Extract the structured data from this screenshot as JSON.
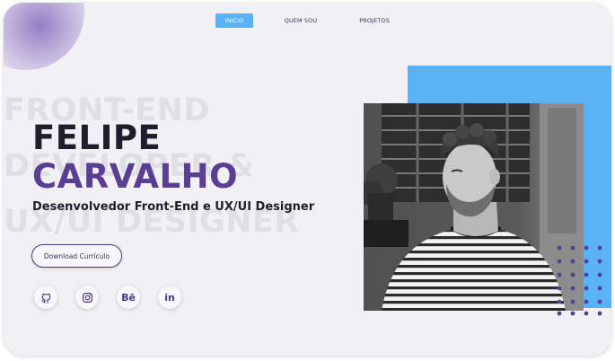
{
  "nav": {
    "items": [
      "INICIO",
      "QUEM SOU",
      "PROJETOS"
    ],
    "active": "INICIO"
  },
  "hero": {
    "background_lines": [
      "FRONT-END",
      "DEVELOPER &",
      "UX/UI DESIGNER"
    ],
    "name_first": "FELIPE",
    "name_last": "CARVALHO",
    "subtitle": "Desenvolvedor Front-End e UX/UI Designer",
    "download_label": "Download Currículo"
  },
  "social": [
    {
      "icon": "github-icon",
      "label": ""
    },
    {
      "icon": "instagram-icon",
      "label": ""
    },
    {
      "icon": "behance-icon",
      "label": "Bē"
    },
    {
      "icon": "linkedin-icon",
      "label": "in"
    }
  ],
  "colors": {
    "accent_blue": "#5ab2f5",
    "purple": "#5a3e92",
    "dark": "#211d2c",
    "background": "#f1f0f5"
  }
}
